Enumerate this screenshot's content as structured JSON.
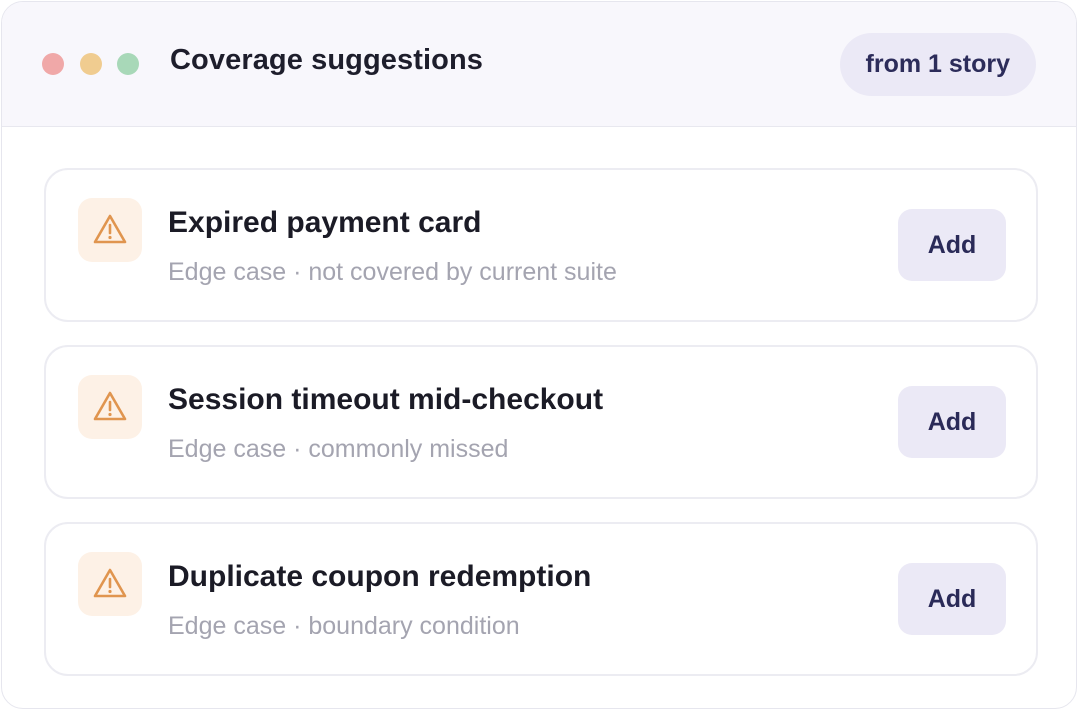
{
  "window": {
    "title": "Coverage suggestions",
    "source_badge": "from 1 story",
    "traffic_lights": [
      "close",
      "minimize",
      "maximize"
    ]
  },
  "suggestions": [
    {
      "icon": "warning-icon",
      "title": "Expired payment card",
      "meta": "Edge case · not covered by current suite",
      "action_label": "Add"
    },
    {
      "icon": "warning-icon",
      "title": "Session timeout mid-checkout",
      "meta": "Edge case · commonly missed",
      "action_label": "Add"
    },
    {
      "icon": "warning-icon",
      "title": "Duplicate coupon redemption",
      "meta": "Edge case · boundary condition",
      "action_label": "Add"
    }
  ],
  "colors": {
    "close": "#f0a8a8",
    "minimize": "#f0cc90",
    "maximize": "#a8d8b8",
    "warning_icon": "#e0954f",
    "warning_icon_bg": "#fdf1e6",
    "button_bg": "#ebe9f6",
    "button_text": "#2a2a58"
  }
}
